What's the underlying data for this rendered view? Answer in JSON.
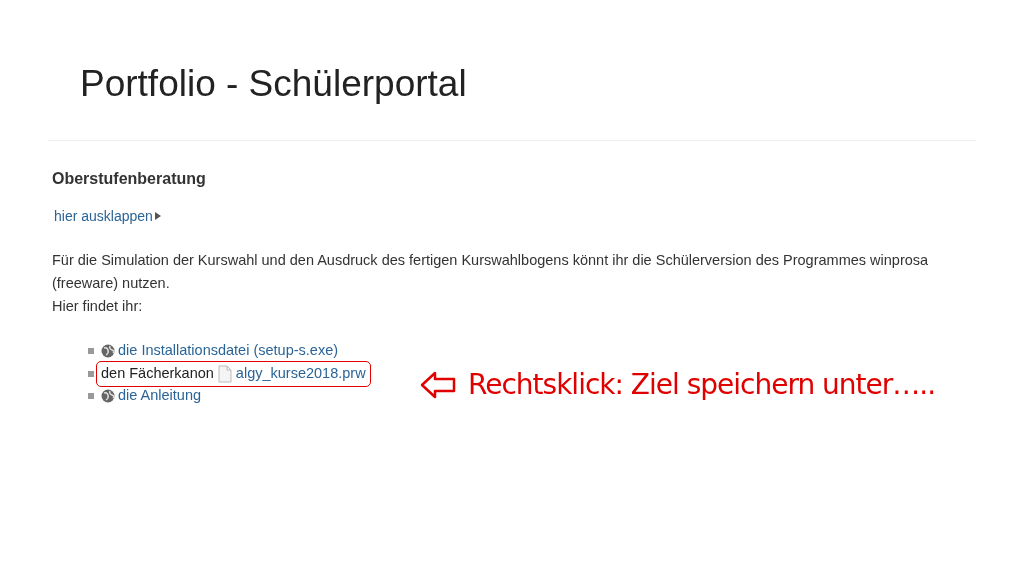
{
  "slide_title": "Portfolio - Schülerportal",
  "page": {
    "heading": "Oberstufenberatung",
    "expand_link": "hier ausklappen",
    "paragraph": "Für die Simulation der Kurswahl und den Ausdruck des fertigen Kurswahlbogens könnt ihr die Schülerversion des Programmes winprosa (freeware) nutzen.",
    "intro": "Hier findet ihr:",
    "items": [
      {
        "kind": "globe-link",
        "link": "die Installationsdatei (setup-s.exe)",
        "highlighted": false
      },
      {
        "kind": "file-link",
        "text": "den Fächerkanon",
        "link": "algy_kurse2018.prw",
        "highlighted": true
      },
      {
        "kind": "globe-link",
        "link": "die Anleitung",
        "highlighted": false
      }
    ]
  },
  "callout": "Rechtsklick: Ziel speichern unter….."
}
